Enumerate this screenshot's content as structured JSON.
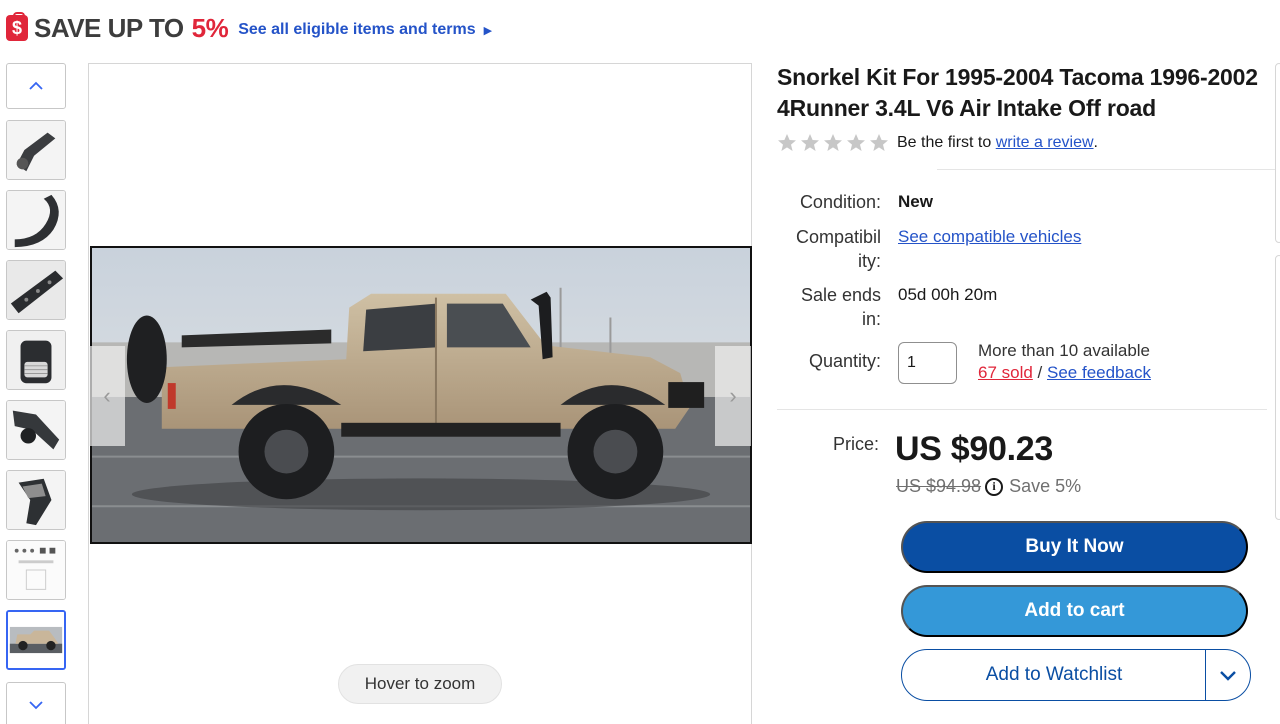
{
  "promo": {
    "title": "SAVE UP TO",
    "percent": "5%",
    "link": "See all eligible items and terms",
    "tag_glyph": "$"
  },
  "gallery": {
    "up_icon": "chevron-up-icon",
    "down_icon": "chevron-down-icon",
    "thumbnails": [
      "snorkel-angle",
      "snorkel-curved",
      "snorkel-bracket",
      "snorkel-head",
      "snorkel-pipe",
      "snorkel-intake",
      "hardware-kit",
      "truck-side"
    ],
    "selected_index": 7,
    "prev_glyph": "‹",
    "next_glyph": "›",
    "zoom_hint": "Hover to zoom"
  },
  "listing": {
    "title": "Snorkel Kit For 1995-2004 Tacoma 1996-2002 4Runner 3.4L V6 Air Intake Off road",
    "review_prefix": "Be the first to",
    "review_link": "write a review",
    "review_suffix": ".",
    "stars_filled": 0,
    "condition_label": "Condition:",
    "condition_value": "New",
    "compat_label_1": "Compatibil",
    "compat_label_2": "ity:",
    "compat_link": "See compatible vehicles",
    "ends_label_1": "Sale ends",
    "ends_label_2": "in:",
    "ends_value": "05d 00h 20m",
    "quantity_label": "Quantity:",
    "quantity_value": "1",
    "available": "More than 10 available",
    "sold": "67 sold",
    "sold_sep": " / ",
    "feedback": "See feedback",
    "price_label": "Price:",
    "price": "US $90.23",
    "was_price": "US $94.98",
    "save": "Save 5%",
    "info_glyph": "i"
  },
  "actions": {
    "buy_now": "Buy It Now",
    "add_to_cart": "Add to cart",
    "watchlist": "Add to Watchlist"
  },
  "colors": {
    "accent_red": "#e0263a",
    "link_blue": "#2453c8",
    "buy_blue": "#0a4ea3",
    "cart_blue": "#3498d8"
  }
}
